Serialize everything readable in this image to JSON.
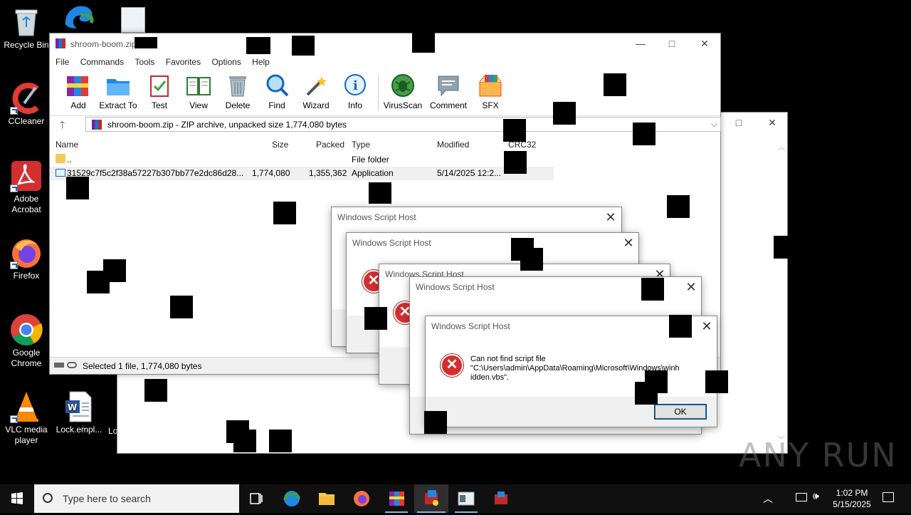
{
  "desktop": {
    "icons": [
      {
        "label": "Recycle Bin"
      },
      {
        "label": "CCleaner"
      },
      {
        "label": "Adobe Acrobat"
      },
      {
        "label": "Firefox"
      },
      {
        "label": "Google Chrome"
      },
      {
        "label": "VLC media player"
      },
      {
        "label": "Lock.empl..."
      },
      {
        "label": "Lo"
      }
    ]
  },
  "winrar": {
    "title": "shroom-boom.zip",
    "menu": [
      "File",
      "Commands",
      "Tools",
      "Favorites",
      "Options",
      "Help"
    ],
    "toolbar": [
      "Add",
      "Extract To",
      "Test",
      "View",
      "Delete",
      "Find",
      "Wizard",
      "Info",
      "VirusScan",
      "Comment",
      "SFX"
    ],
    "address": "shroom-boom.zip - ZIP archive, unpacked size 1,774,080 bytes",
    "columns": [
      "Name",
      "Size",
      "Packed",
      "Type",
      "Modified",
      "CRC32"
    ],
    "rows": [
      {
        "name": "..",
        "size": "",
        "packed": "",
        "type": "File folder",
        "modified": ""
      },
      {
        "name": "31529c7f5c2f38a57227b307bb77e2dc86d28...",
        "size": "1,774,080",
        "packed": "1,355,362",
        "type": "Application",
        "modified": "5/14/2025 12:2..."
      }
    ],
    "status": "Selected 1 file, 1,774,080 bytes"
  },
  "dialogs": {
    "title": "Windows Script Host",
    "message_line1": "Can not find script file",
    "message_line2": "\"C:\\Users\\admin\\AppData\\Roaming\\Microsoft\\Windows\\winh",
    "message_line3": "idden.vbs\".",
    "ok_label": "OK"
  },
  "taskbar": {
    "search_placeholder": "Type here to search",
    "time": "1:02 PM",
    "date": "5/15/2025"
  },
  "watermark": "ANY RUN",
  "colors": {
    "accent": "#0078d7",
    "error": "#d32f2f",
    "taskbar": "#101010"
  }
}
